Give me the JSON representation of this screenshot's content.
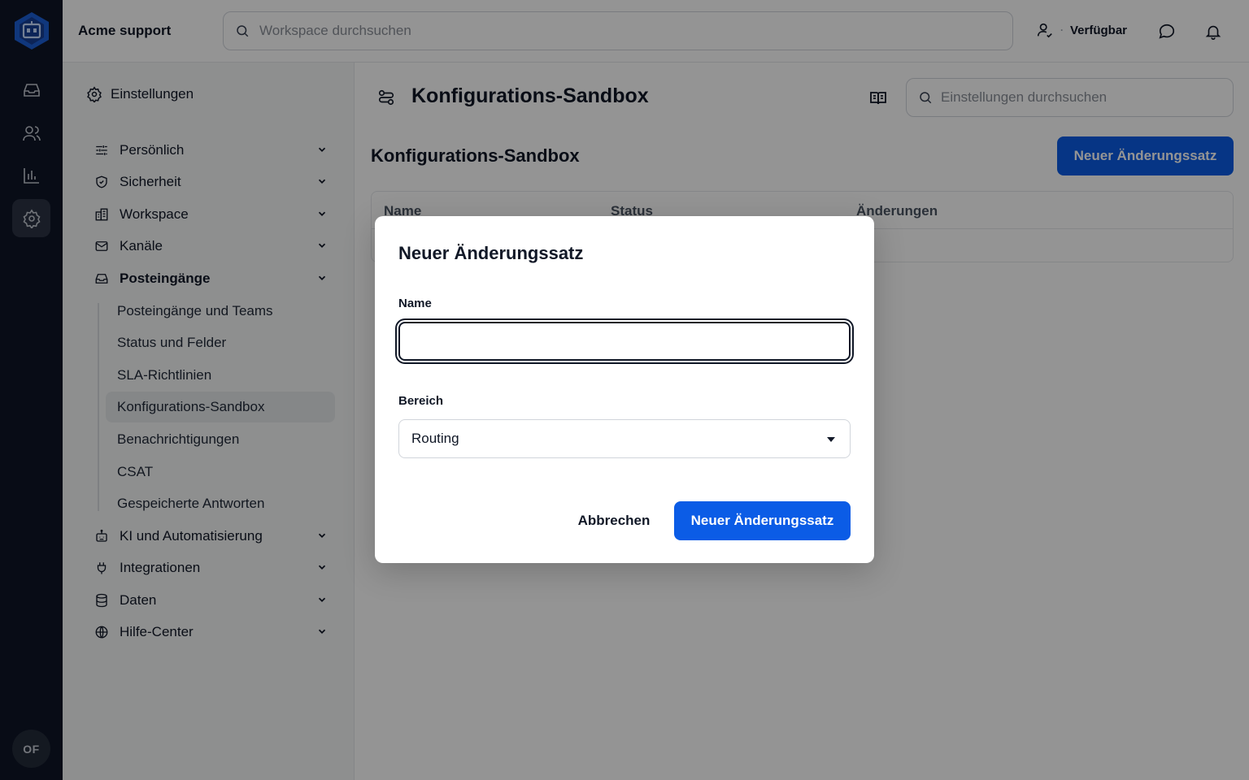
{
  "topbar": {
    "brand": "Acme support",
    "search_placeholder": "Workspace durchsuchen",
    "status_label": "Verfügbar",
    "status_separator": "·"
  },
  "rail": {
    "items": [
      "inbox-icon",
      "users-icon",
      "bar-chart-icon",
      "gear-icon"
    ],
    "active": "gear-icon",
    "avatar_initials": "OF"
  },
  "sidebar": {
    "heading": "Einstellungen",
    "groups": [
      {
        "label": "Persönlich",
        "icon": "sliders-icon"
      },
      {
        "label": "Sicherheit",
        "icon": "shield-icon"
      },
      {
        "label": "Workspace",
        "icon": "building-icon"
      },
      {
        "label": "Kanäle",
        "icon": "mail-icon"
      },
      {
        "label": "Posteingänge",
        "icon": "inbox-icon",
        "expanded": true
      },
      {
        "label": "KI und Automatisierung",
        "icon": "robot-icon"
      },
      {
        "label": "Integrationen",
        "icon": "plug-icon"
      },
      {
        "label": "Daten",
        "icon": "database-icon"
      },
      {
        "label": "Hilfe-Center",
        "icon": "globe-icon"
      }
    ],
    "sub_items": [
      "Posteingänge und Teams",
      "Status und Felder",
      "SLA-Richtlinien",
      "Konfigurations-Sandbox",
      "Benachrichtigungen",
      "CSAT",
      "Gespeicherte Antworten"
    ],
    "active_sub": "Konfigurations-Sandbox"
  },
  "main": {
    "page_title": "Konfigurations-Sandbox",
    "settings_search_placeholder": "Einstellungen durchsuchen",
    "section_title": "Konfigurations-Sandbox",
    "new_button": "Neuer Änderungssatz",
    "table_headers": [
      "Name",
      "Status",
      "Änderungen"
    ]
  },
  "modal": {
    "title": "Neuer Änderungssatz",
    "name_label": "Name",
    "name_value": "",
    "scope_label": "Bereich",
    "scope_value": "Routing",
    "cancel": "Abbrechen",
    "submit": "Neuer Änderungssatz"
  },
  "colors": {
    "rail_bg": "#0e1526",
    "primary": "#0b5ce6",
    "overlay": "rgba(0,0,0,0.42)"
  }
}
